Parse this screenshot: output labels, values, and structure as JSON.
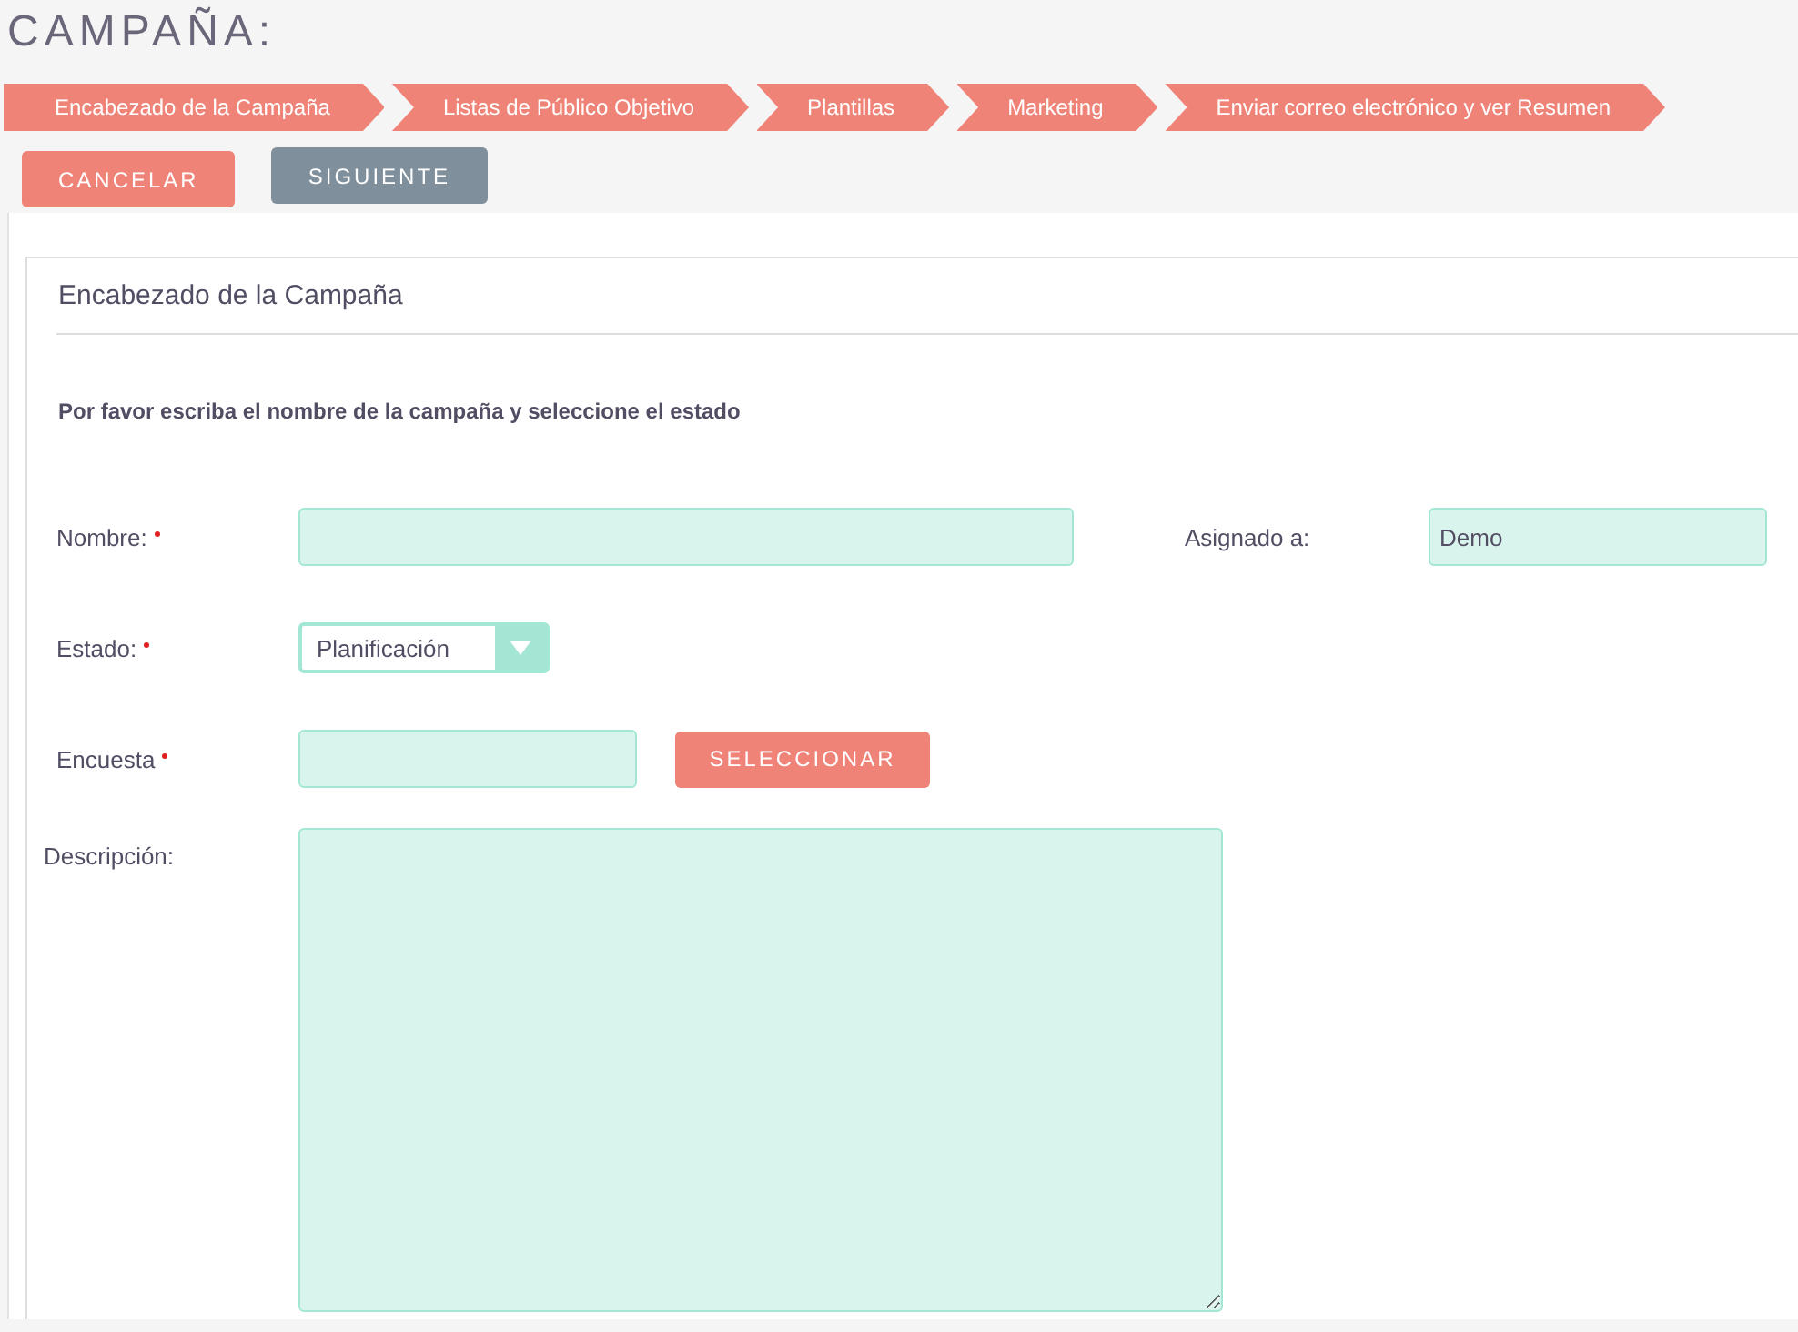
{
  "page_title": "CAMPAÑA:",
  "steps": [
    {
      "label": "Encabezado de la Campaña"
    },
    {
      "label": "Listas de Público Objetivo"
    },
    {
      "label": "Plantillas"
    },
    {
      "label": "Marketing"
    },
    {
      "label": "Enviar correo electrónico y ver Resumen"
    }
  ],
  "actions": [
    {
      "label": "CANCELAR",
      "kind": "primary"
    },
    {
      "label": "SIGUIENTE",
      "kind": "secondary"
    }
  ],
  "panel": {
    "title": "Encabezado de la Campaña",
    "instructions": "Por favor escriba el nombre de la campaña y seleccione el estado",
    "fields": {
      "nombre": {
        "label": "Nombre:",
        "required": true
      },
      "asignado": {
        "label": "Asignado a:",
        "required": false,
        "value": "Demo"
      },
      "estado": {
        "label": "Estado:",
        "required": true,
        "value": "Planificación"
      },
      "encuesta": {
        "label": "Encuesta",
        "required": true,
        "button": "SELECCIONAR"
      },
      "descripcion": {
        "label": "Descripción:",
        "required": false
      }
    }
  }
}
